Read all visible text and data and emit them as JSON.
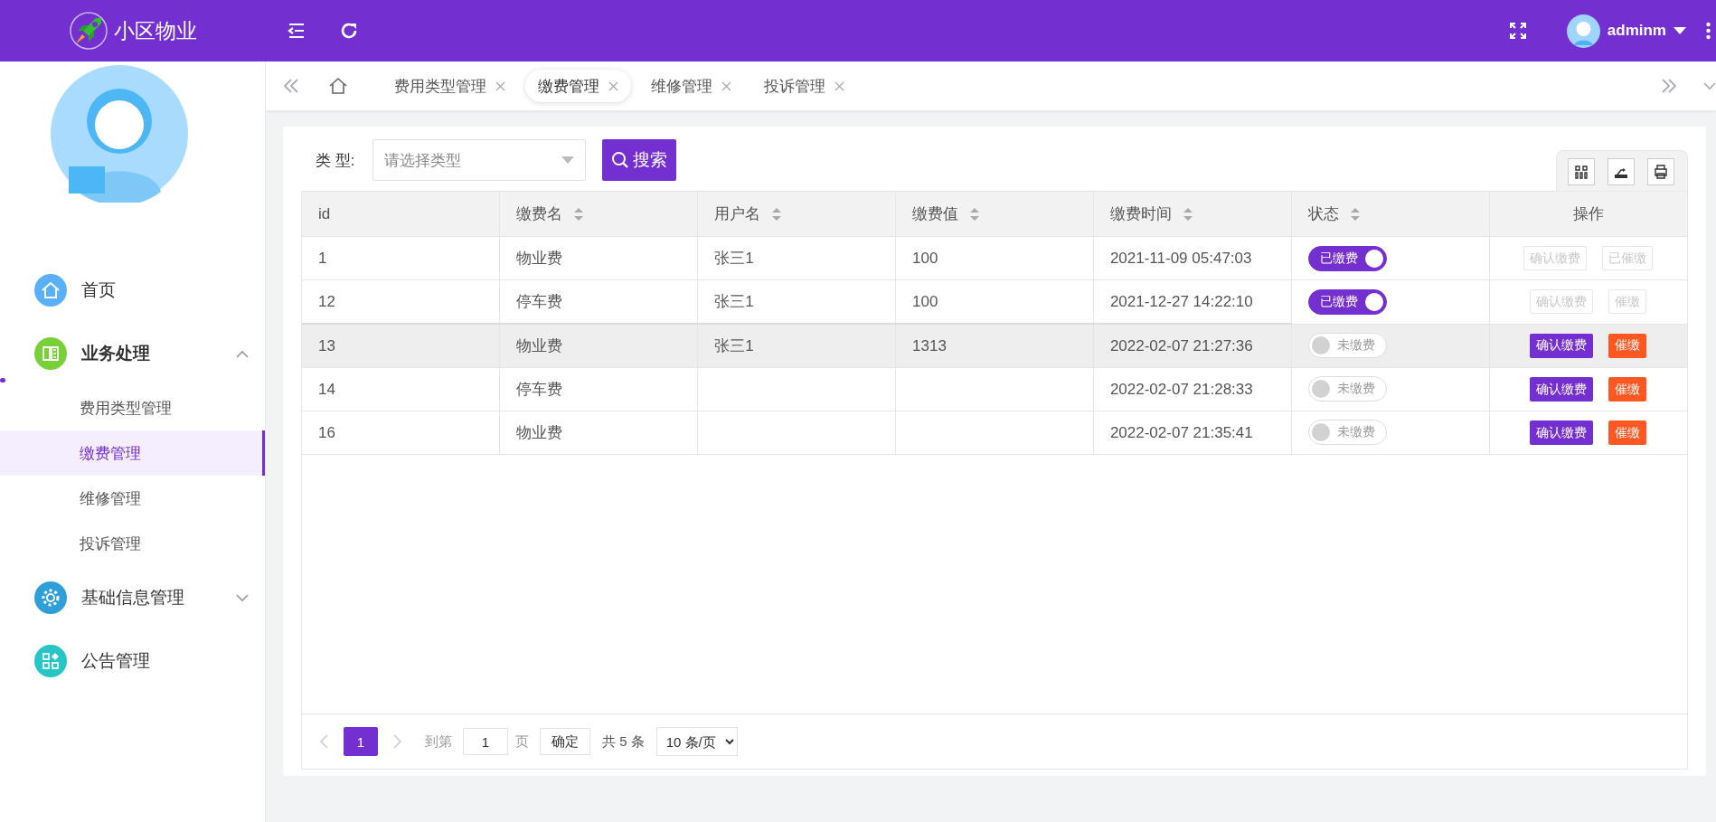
{
  "header": {
    "title": "小区物业",
    "user": "adminm"
  },
  "sidebar": {
    "items": [
      {
        "label": "首页",
        "kind": "link",
        "color": "#5ab0f7"
      },
      {
        "label": "业务处理",
        "kind": "group",
        "color": "#79d13a",
        "expanded": true,
        "children": [
          {
            "label": "费用类型管理",
            "selected": false
          },
          {
            "label": "缴费管理",
            "selected": true
          },
          {
            "label": "维修管理",
            "selected": false
          },
          {
            "label": "投诉管理",
            "selected": false
          }
        ]
      },
      {
        "label": "基础信息管理",
        "kind": "group",
        "color": "#2f9fd8",
        "expanded": false
      },
      {
        "label": "公告管理",
        "kind": "link",
        "color": "#26c6c6"
      }
    ]
  },
  "tabs": [
    {
      "label": "费用类型管理",
      "selected": false
    },
    {
      "label": "缴费管理",
      "selected": true
    },
    {
      "label": "维修管理",
      "selected": false
    },
    {
      "label": "投诉管理",
      "selected": false
    }
  ],
  "filter": {
    "label": "类 型:",
    "placeholder": "请选择类型",
    "button": "搜索"
  },
  "table": {
    "columns": [
      {
        "label": "id",
        "sortable": false
      },
      {
        "label": "缴费名",
        "sortable": true
      },
      {
        "label": "用户名",
        "sortable": true
      },
      {
        "label": "缴费值",
        "sortable": true
      },
      {
        "label": "缴费时间",
        "sortable": true
      },
      {
        "label": "状态",
        "sortable": true
      },
      {
        "label": "操作",
        "sortable": false
      }
    ],
    "rows": [
      {
        "id": "1",
        "name": "物业费",
        "user": "张三1",
        "amount": "100",
        "time": "2021-11-09 05:47:03",
        "status": {
          "label": "已缴费",
          "paid": true
        },
        "highlighted": false,
        "actions": [
          {
            "label": "确认缴费",
            "kind": "confirm",
            "disabled": true
          },
          {
            "label": "已催缴",
            "kind": "remind",
            "disabled": true
          }
        ]
      },
      {
        "id": "12",
        "name": "停车费",
        "user": "张三1",
        "amount": "100",
        "time": "2021-12-27 14:22:10",
        "status": {
          "label": "已缴费",
          "paid": true
        },
        "highlighted": false,
        "actions": [
          {
            "label": "确认缴费",
            "kind": "confirm",
            "disabled": true
          },
          {
            "label": "催缴",
            "kind": "remind",
            "disabled": true
          }
        ]
      },
      {
        "id": "13",
        "name": "物业费",
        "user": "张三1",
        "amount": "1313",
        "time": "2022-02-07 21:27:36",
        "status": {
          "label": "未缴费",
          "paid": false
        },
        "highlighted": true,
        "actions": [
          {
            "label": "确认缴费",
            "kind": "confirm",
            "disabled": false
          },
          {
            "label": "催缴",
            "kind": "remind",
            "disabled": false
          }
        ]
      },
      {
        "id": "14",
        "name": "停车费",
        "time": "2022-02-07 21:28:33",
        "status": {
          "label": "未缴费",
          "paid": false
        },
        "highlighted": false,
        "actions": [
          {
            "label": "确认缴费",
            "kind": "confirm",
            "disabled": false
          },
          {
            "label": "催缴",
            "kind": "remind",
            "disabled": false
          }
        ]
      },
      {
        "id": "16",
        "name": "物业费",
        "time": "2022-02-07 21:35:41",
        "status": {
          "label": "未缴费",
          "paid": false
        },
        "highlighted": false,
        "actions": [
          {
            "label": "确认缴费",
            "kind": "confirm",
            "disabled": false
          },
          {
            "label": "催缴",
            "kind": "remind",
            "disabled": false
          }
        ]
      }
    ]
  },
  "pagination": {
    "pages": [
      {
        "label": "1",
        "selected": true
      }
    ],
    "goto_label": "到第",
    "page_value": "1",
    "page_unit": "页",
    "confirm": "确定",
    "total": "共 5 条",
    "page_size": "10 条/页"
  }
}
